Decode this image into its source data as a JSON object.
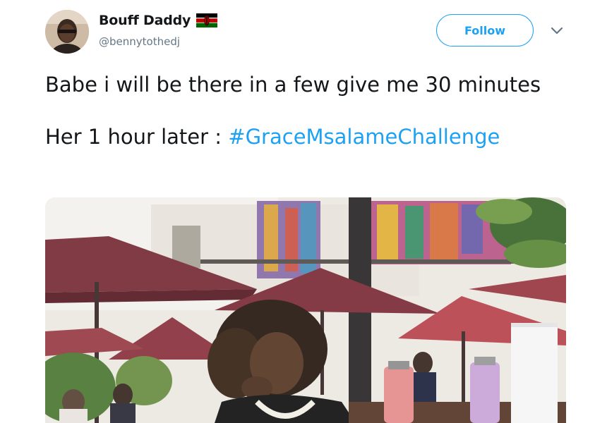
{
  "author": {
    "display_name": "Bouff Daddy",
    "handle": "@bennytothedj",
    "flag_icon": "kenya-flag-icon",
    "avatar_icon": "profile-avatar"
  },
  "actions": {
    "follow_label": "Follow",
    "menu_icon": "chevron-down-icon"
  },
  "tweet": {
    "line1": "Babe i will be there in a few give me 30 minutes",
    "line2_prefix": "Her 1 hour later : ",
    "hashtag": "#GraceMsalameChallenge"
  },
  "media": {
    "description_icon": "tweet-photo"
  },
  "colors": {
    "accent": "#1da1f2",
    "text": "#14171a",
    "secondary_text": "#657786"
  }
}
